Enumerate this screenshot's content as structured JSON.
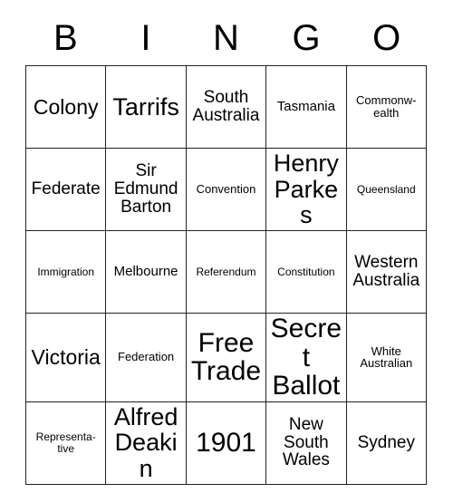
{
  "card": {
    "header_letters": [
      "B",
      "I",
      "N",
      "G",
      "O"
    ],
    "rows": [
      [
        {
          "text": "Colony",
          "size": "fs-lg"
        },
        {
          "text": "Tarrifs",
          "size": "fs-xl"
        },
        {
          "text": "South Australia",
          "size": "fs-md"
        },
        {
          "text": "Tasmania",
          "size": "fs-sm"
        },
        {
          "text": "Commonw-ealth",
          "size": "fs-xs"
        }
      ],
      [
        {
          "text": "Federate",
          "size": "fs-md"
        },
        {
          "text": "Sir Edmund Barton",
          "size": "fs-md"
        },
        {
          "text": "Convention",
          "size": "fs-xs"
        },
        {
          "text": "Henry Parkes",
          "size": "fs-xl"
        },
        {
          "text": "Queensland",
          "size": "fs-xxs"
        }
      ],
      [
        {
          "text": "Immigration",
          "size": "fs-xxs"
        },
        {
          "text": "Melbourne",
          "size": "fs-sm"
        },
        {
          "text": "Referendum",
          "size": "fs-xxs"
        },
        {
          "text": "Constitution",
          "size": "fs-xxs"
        },
        {
          "text": "Western Australia",
          "size": "fs-md"
        }
      ],
      [
        {
          "text": "Victoria",
          "size": "fs-lg"
        },
        {
          "text": "Federation",
          "size": "fs-xs"
        },
        {
          "text": "Free Trade",
          "size": "fs-xxl"
        },
        {
          "text": "Secret Ballot",
          "size": "fs-xxl"
        },
        {
          "text": "White Australian",
          "size": "fs-xs"
        }
      ],
      [
        {
          "text": "Representa-tive",
          "size": "fs-xxs"
        },
        {
          "text": "Alfred Deakin",
          "size": "fs-xl"
        },
        {
          "text": "1901",
          "size": "fs-xxl"
        },
        {
          "text": "New South Wales",
          "size": "fs-md"
        },
        {
          "text": "Sydney",
          "size": "fs-md"
        }
      ]
    ]
  }
}
